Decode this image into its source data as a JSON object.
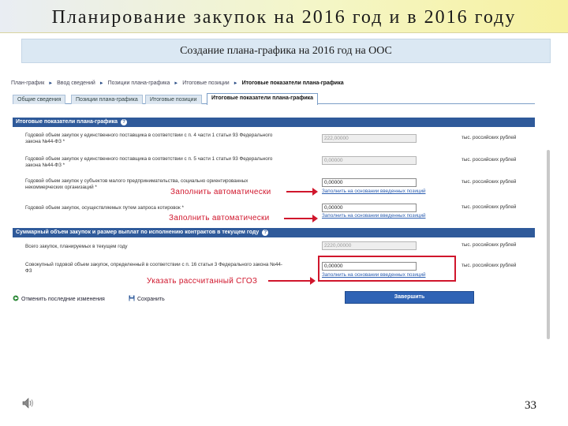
{
  "slide": {
    "title": "Планирование закупок на 2016 год и в 2016 году",
    "subtitle": "Создание плана-графика на 2016 год на ООС",
    "page_number": "33"
  },
  "breadcrumbs": [
    "План-график",
    "Ввод сведений",
    "Позиции плана-графика",
    "Итоговые позиции",
    "Итоговые показатели плана-графика"
  ],
  "tabs": [
    "Общие сведения",
    "Позиции плана-графика",
    "Итоговые позиции",
    "Итоговые показатели плана-графика"
  ],
  "section1": {
    "header": "Итоговые показатели плана-графика",
    "rows": [
      {
        "label": "Годовой объем закупок у единственного поставщика в соответствии с п. 4 части 1 статьи 93 Федерального закона №44-ФЗ *",
        "value": "222,00000",
        "unit": "тыс. российских рублей",
        "link": ""
      },
      {
        "label": "Годовой объем закупок у единственного поставщика в соответствии с п. 5 части 1 статьи 93 Федерального закона №44-ФЗ *",
        "value": "0,00000",
        "unit": "тыс. российских рублей",
        "link": ""
      },
      {
        "label": "Годовой объем закупок у субъектов малого предпринимательства, социально ориентированных некоммерческих организаций *",
        "value": "0,00000",
        "unit": "тыс. российских рублей",
        "link": "Заполнить на основании введенных позиций"
      },
      {
        "label": "Годовой объем закупок, осуществляемых путем запроса котировок *",
        "value": "0,00000",
        "unit": "тыс. российских рублей",
        "link": "Заполнить на основании введенных позиций"
      }
    ]
  },
  "section2": {
    "header": "Суммарный объем закупок и размер выплат по исполнению контрактов в текущем году",
    "rows": [
      {
        "label": "Всего закупок, планируемых в текущем году",
        "value": "2220,00000",
        "unit": "тыс. российских рублей",
        "link": ""
      },
      {
        "label": "Совокупный годовой объем закупок, определенный в соответствии с п. 16 статьи 3 Федерального закона №44-ФЗ",
        "value": "0,00000",
        "unit": "тыс. российских рублей",
        "link": "Заполнить на основании введенных позиций"
      }
    ]
  },
  "annotations": {
    "auto1": "Заполнить автоматически",
    "auto2": "Заполнить автоматически",
    "calc": "Указать рассчитанный СГОЗ"
  },
  "actions": {
    "cancel": "Отменить последние изменения",
    "save": "Сохранить",
    "finish": "Завершить"
  },
  "colors": {
    "accent_blue": "#2f5a9a",
    "annotation_red": "#d0162c"
  }
}
